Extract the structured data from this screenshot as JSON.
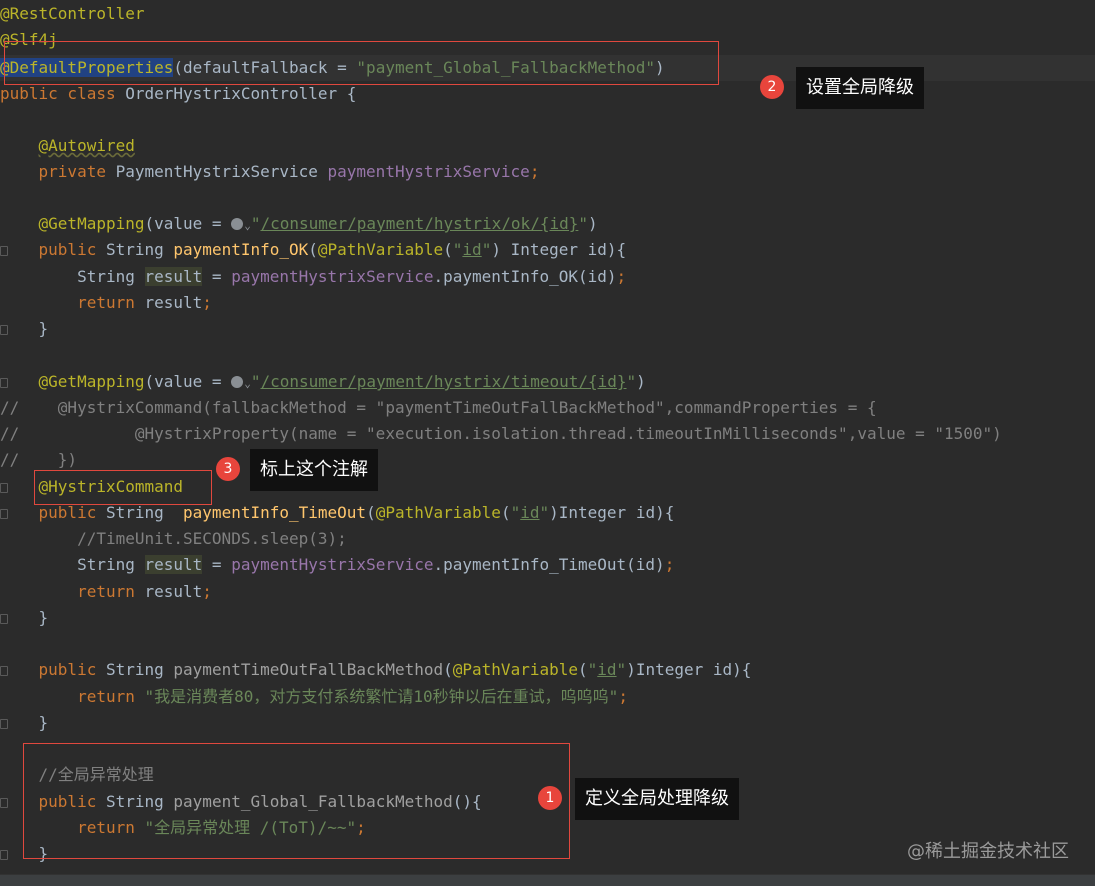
{
  "code": {
    "l1": "@RestController",
    "l2": "@Slf4j",
    "l3_ann": "@DefaultProperties",
    "l3_open": "(defaultFallback = ",
    "l3_str": "\"payment_Global_FallbackMethod\"",
    "l3_close": ")",
    "l4_kw": "public class ",
    "l4_rest": "OrderHystrixController {",
    "l6": "@Autowired",
    "l7_kw": "private ",
    "l7_type": "PaymentHystrixService ",
    "l7_field": "paymentHystrixService",
    "l7_semi": ";",
    "l9_ann": "@GetMapping",
    "l9_open": "(value = ",
    "l9_q1": "\"",
    "l9_url": "/consumer/payment/hystrix/ok/{id}",
    "l9_q2": "\"",
    "l9_close": ")",
    "l10_kw": "public ",
    "l10_type": "String ",
    "l10_fn": "paymentInfo_OK",
    "l10_p1": "(",
    "l10_ann": "@PathVariable",
    "l10_p2": "(",
    "l10_q1": "\"",
    "l10_id": "id",
    "l10_q2": "\"",
    "l10_rest": ") Integer id){",
    "l11_type": "String ",
    "l11_var": "result",
    "l11_eq": " = ",
    "l11_field": "paymentHystrixService",
    "l11_call": ".paymentInfo_OK(id)",
    "l11_semi": ";",
    "l12_kw": "return ",
    "l12_rest": "result",
    "l12_semi": ";",
    "l13": "}",
    "l15_ann": "@GetMapping",
    "l15_open": "(value = ",
    "l15_q1": "\"",
    "l15_url": "/consumer/payment/hystrix/timeout/{id}",
    "l15_q2": "\"",
    "l15_close": ")",
    "l16": "//    @HystrixCommand(fallbackMethod = \"paymentTimeOutFallBackMethod\",commandProperties = {",
    "l17": "//            @HystrixProperty(name = \"execution.isolation.thread.timeoutInMilliseconds\",value = \"1500\")",
    "l18": "//    })",
    "l19": "@HystrixCommand",
    "l20_kw": "public ",
    "l20_type": "String  ",
    "l20_fn": "paymentInfo_TimeOut",
    "l20_p1": "(",
    "l20_ann": "@PathVariable",
    "l20_p2": "(",
    "l20_q1": "\"",
    "l20_id": "id",
    "l20_q2": "\"",
    "l20_rest": ")Integer id){",
    "l21": "//TimeUnit.SECONDS.sleep(3);",
    "l22_type": "String ",
    "l22_var": "result",
    "l22_eq": " = ",
    "l22_field": "paymentHystrixService",
    "l22_call": ".paymentInfo_TimeOut(id)",
    "l22_semi": ";",
    "l23_kw": "return ",
    "l23_rest": "result",
    "l23_semi": ";",
    "l24": "}",
    "l26_kw": "public ",
    "l26_type": "String ",
    "l26_fn": "paymentTimeOutFallBackMethod",
    "l26_p1": "(",
    "l26_ann": "@PathVariable",
    "l26_p2": "(",
    "l26_q1": "\"",
    "l26_id": "id",
    "l26_q2": "\"",
    "l26_rest": ")Integer id){",
    "l27_kw": "return ",
    "l27_str": "\"我是消费者80，对方支付系统繁忙请10秒钟以后在重试，呜呜呜\"",
    "l27_semi": ";",
    "l28": "}",
    "l30": "//全局异常处理",
    "l31_kw": "public ",
    "l31_type": "String ",
    "l31_fn": "payment_Global_FallbackMethod",
    "l31_rest": "(){",
    "l32_kw": "return ",
    "l32_str": "\"全局异常处理 /(ToT)/~~\"",
    "l32_semi": ";",
    "l33": "}",
    "ind1": "    ",
    "ind2": "        "
  },
  "callouts": [
    {
      "number": "1",
      "text": "定义全局处理降级"
    },
    {
      "number": "2",
      "text": "设置全局降级"
    },
    {
      "number": "3",
      "text": "标上这个注解"
    }
  ],
  "watermark": "@稀土掘金技术社区",
  "colors": {
    "background": "#2b2b2b",
    "keyword": "#cc7832",
    "annotation": "#bbb529",
    "string": "#6a8759",
    "field": "#9876aa",
    "method": "#ffc66d",
    "callout_box": "#e0483e",
    "badge": "#e8453c"
  },
  "icons": [
    "web-globe-icon",
    "chevron-down-icon",
    "fold-marker-icon"
  ]
}
